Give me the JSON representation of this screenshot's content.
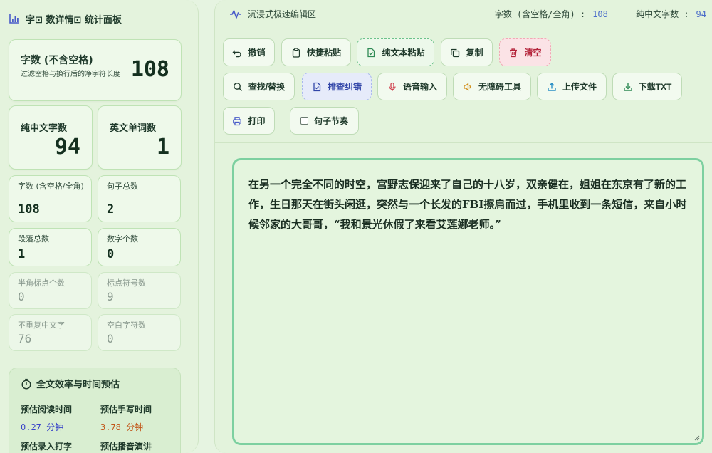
{
  "sidebar": {
    "title": "字⊡ 数详情⊡ 统计面板",
    "stats_main": {
      "label": "字数 (不含空格)",
      "desc": "过滤空格与换行后的净字符长度",
      "value": "108"
    },
    "stats_cn": {
      "label": "纯中文字数",
      "value": "94"
    },
    "stats_en": {
      "label": "英文单词数",
      "value": "1"
    },
    "small": [
      {
        "label": "字数 (含空格/全角)",
        "value": "108"
      },
      {
        "label": "句子总数",
        "value": "2"
      },
      {
        "label": "段落总数",
        "value": "1"
      },
      {
        "label": "数字个数",
        "value": "0"
      },
      {
        "label": "半角标点个数",
        "value": "0"
      },
      {
        "label": "标点符号数",
        "value": "9"
      },
      {
        "label": "不重复中文字",
        "value": "76"
      },
      {
        "label": "空白字符数",
        "value": "0"
      }
    ],
    "efficiency": {
      "title": "全文效率与时间预估",
      "read_label": "预估阅读时间",
      "read_value": "0.27 分钟",
      "write_label": "预估手写时间",
      "write_value": "3.78 分钟",
      "type_label": "预估录入打字",
      "speech_label": "预估播音演讲"
    }
  },
  "topbar": {
    "title": "沉浸式极速编辑区",
    "count_label": "字数 (含空格/全角) :",
    "count_value": "108",
    "sep": "|",
    "cn_label": "纯中文字数 :",
    "cn_value": "94"
  },
  "toolbar": {
    "undo": "撤销",
    "paste": "快捷粘贴",
    "plain_paste": "纯文本粘贴",
    "copy": "复制",
    "clear": "清空",
    "find": "查找/替换",
    "check": "排查纠错",
    "voice": "语音输入",
    "a11y": "无障碍工具",
    "upload": "上传文件",
    "download": "下载TXT",
    "print": "打印",
    "rhythm": "句子节奏"
  },
  "editor": {
    "text": "在另一个完全不同的时空，宫野志保迎来了自己的十八岁，双亲健在，姐姐在东京有了新的工作，生日那天在街头闲逛，突然与一个长发的FBI擦肩而过，手机里收到一条短信，来自小时候邻家的大哥哥，“我和景光休假了来看艾莲娜老师。”"
  },
  "colors": {
    "accent": "#7dd0a0",
    "danger": "#b4233a",
    "blue": "#3145a8",
    "read_value": "#3b46c9",
    "write_value": "#c2571a"
  }
}
